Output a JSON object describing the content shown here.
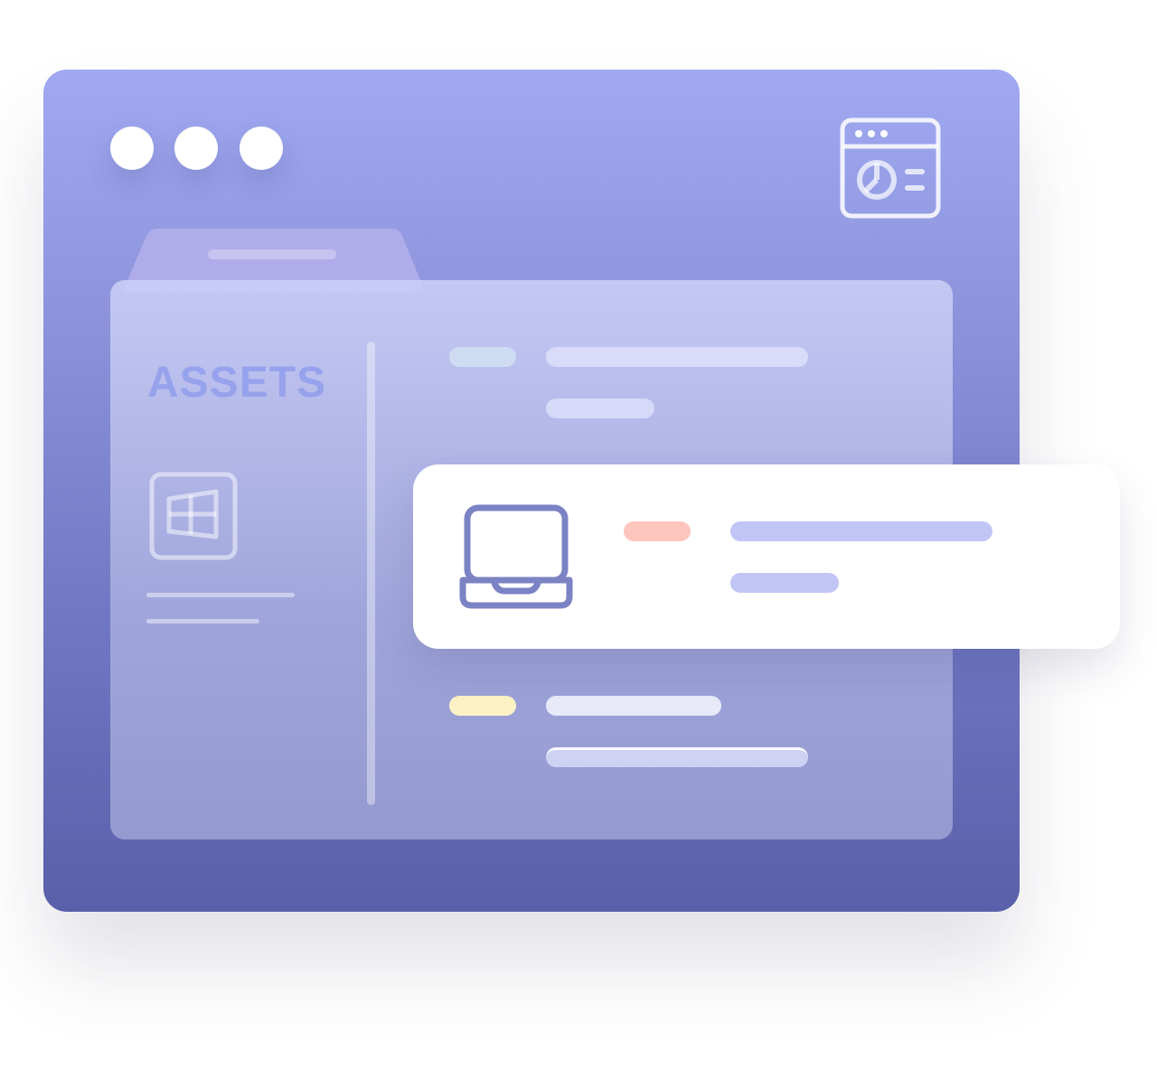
{
  "folder": {
    "label": "ASSETS"
  },
  "colors": {
    "window_top": "#a0a9f1",
    "window_bottom": "#5a5fa9",
    "card_icon": "#7b83c4",
    "badge_blue": "#cddcf2",
    "badge_orange": "#fdc5bc",
    "badge_yellow": "#fcf2c6",
    "card_line": "#c0c5f6"
  },
  "icons": [
    "dot-icon",
    "browser-chart-icon",
    "windows-logo-icon",
    "laptop-icon"
  ]
}
